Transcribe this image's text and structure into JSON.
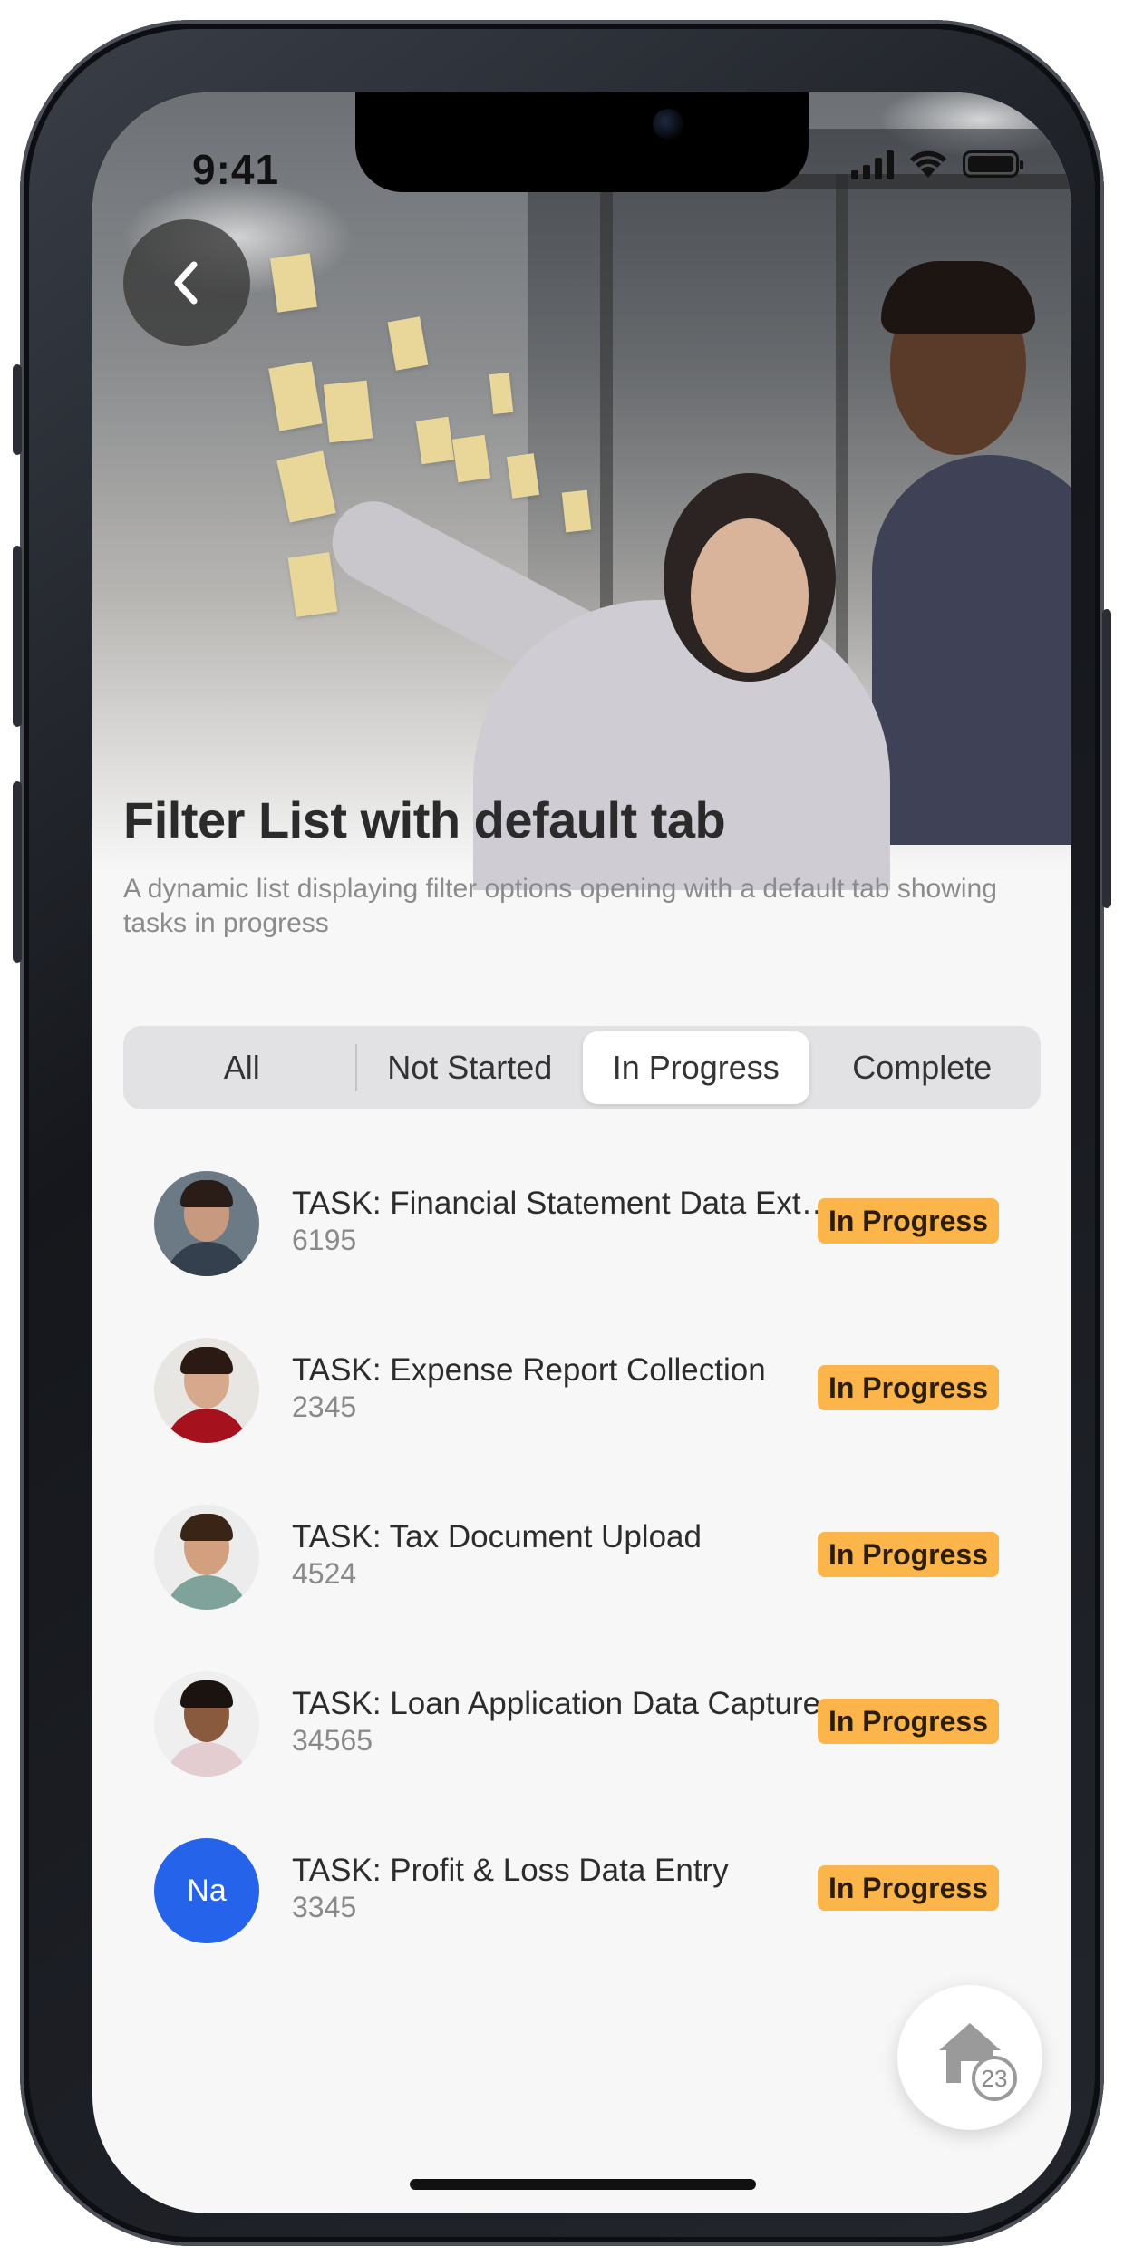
{
  "status_bar": {
    "time": "9:41"
  },
  "header": {
    "title": "Filter List with default tab",
    "subtitle": "A dynamic list displaying filter options opening with a default tab showing tasks in progress"
  },
  "tabs": [
    {
      "label": "All",
      "active": false
    },
    {
      "label": "Not Started",
      "active": false
    },
    {
      "label": "In Progress",
      "active": true
    },
    {
      "label": "Complete",
      "active": false
    }
  ],
  "tasks": [
    {
      "title": "TASK: Financial Statement Data Extr...",
      "id": "6195",
      "status": "In Progress",
      "avatar": "photo"
    },
    {
      "title": "TASK: Expense Report Collection",
      "id": "2345",
      "status": "In Progress",
      "avatar": "photo"
    },
    {
      "title": "TASK: Tax Document Upload",
      "id": "4524",
      "status": "In Progress",
      "avatar": "photo"
    },
    {
      "title": "TASK: Loan Application Data Capture",
      "id": "34565",
      "status": "In Progress",
      "avatar": "photo"
    },
    {
      "title": "TASK: Profit & Loss Data Entry",
      "id": "3345",
      "status": "In Progress",
      "avatar": "initials",
      "initials": "Na"
    }
  ],
  "fab": {
    "icon": "home-icon",
    "count": "23"
  },
  "colors": {
    "badge": "#fbb54a",
    "initials_avatar": "#2563eb",
    "tab_bar": "#e2e2e4"
  }
}
